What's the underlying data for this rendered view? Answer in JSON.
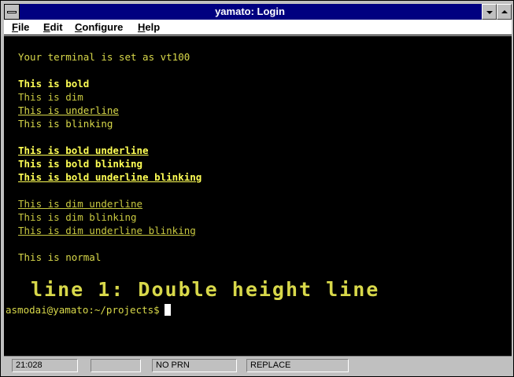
{
  "window": {
    "title": "yamato: Login"
  },
  "menu": {
    "items": [
      {
        "mnemonic": "F",
        "rest": "ile"
      },
      {
        "mnemonic": "E",
        "rest": "dit"
      },
      {
        "mnemonic": "C",
        "rest": "onfigure"
      },
      {
        "mnemonic": "H",
        "rest": "elp"
      }
    ]
  },
  "terminal": {
    "lines": [
      {
        "text": "Your terminal is set as vt100",
        "style": "normal"
      },
      {
        "text": "This is bold",
        "style": "bold"
      },
      {
        "text": "This is dim",
        "style": "dim"
      },
      {
        "text": "This is underline",
        "style": "normal underline"
      },
      {
        "text": "This is blinking",
        "style": "normal blinking"
      },
      {
        "text": "This is bold underline",
        "style": "bold underline"
      },
      {
        "text": "This is bold blinking",
        "style": "bold blinking"
      },
      {
        "text": "This is bold underline blinking",
        "style": "bold underline blinking"
      },
      {
        "text": "This is dim underline",
        "style": "dim underline"
      },
      {
        "text": "This is dim blinking",
        "style": "dim blinking"
      },
      {
        "text": "This is dim underline blinking",
        "style": "dim underline blinking"
      },
      {
        "text": "This is normal",
        "style": "normal"
      }
    ],
    "double_height_line": "line 1: Double height line",
    "prompt": "asmodai@yamato:~/projects$"
  },
  "status": {
    "position": "21:028",
    "field2": "",
    "printer": "NO PRN",
    "mode": "REPLACE"
  },
  "colors": {
    "titlebar": "#000080",
    "terminal_bg": "#000000",
    "bold_text": "#ffff55",
    "dim_text": "#c8c840",
    "chrome": "#c0c0c0"
  }
}
